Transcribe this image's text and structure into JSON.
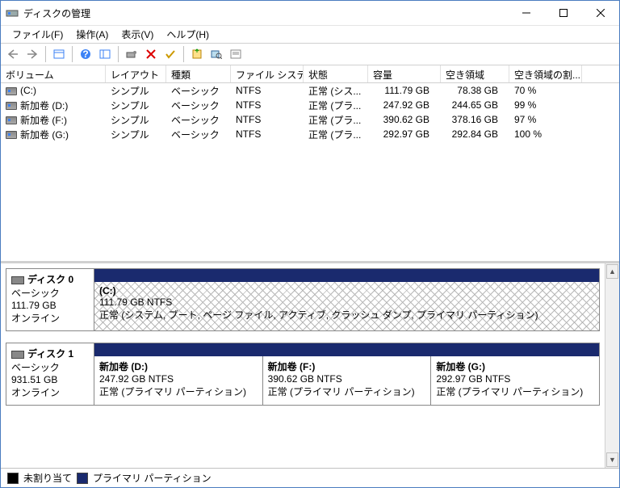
{
  "window": {
    "title": "ディスクの管理"
  },
  "menu": {
    "file": "ファイル(F)",
    "action": "操作(A)",
    "view": "表示(V)",
    "help": "ヘルプ(H)"
  },
  "columns": {
    "volume": "ボリューム",
    "layout": "レイアウト",
    "type": "種類",
    "fs": "ファイル システム",
    "status": "状態",
    "capacity": "容量",
    "free": "空き領域",
    "freepct": "空き領域の割..."
  },
  "volumes": [
    {
      "name": "(C:)",
      "layout": "シンプル",
      "type": "ベーシック",
      "fs": "NTFS",
      "status": "正常 (シス...",
      "capacity": "111.79 GB",
      "free": "78.38 GB",
      "pct": "70 %"
    },
    {
      "name": "新加卷 (D:)",
      "layout": "シンプル",
      "type": "ベーシック",
      "fs": "NTFS",
      "status": "正常 (プラ...",
      "capacity": "247.92 GB",
      "free": "244.65 GB",
      "pct": "99 %"
    },
    {
      "name": "新加卷 (F:)",
      "layout": "シンプル",
      "type": "ベーシック",
      "fs": "NTFS",
      "status": "正常 (プラ...",
      "capacity": "390.62 GB",
      "free": "378.16 GB",
      "pct": "97 %"
    },
    {
      "name": "新加卷 (G:)",
      "layout": "シンプル",
      "type": "ベーシック",
      "fs": "NTFS",
      "status": "正常 (プラ...",
      "capacity": "292.97 GB",
      "free": "292.84 GB",
      "pct": "100 %"
    }
  ],
  "disks": [
    {
      "label": "ディスク 0",
      "type": "ベーシック",
      "size": "111.79 GB",
      "state": "オンライン",
      "parts": [
        {
          "title": "(C:)",
          "sub": "111.79 GB NTFS",
          "desc": "正常 (システム, ブート, ページ ファイル, アクティブ, クラッシュ ダンプ, プライマリ パーティション)",
          "hatch": true
        }
      ]
    },
    {
      "label": "ディスク 1",
      "type": "ベーシック",
      "size": "931.51 GB",
      "state": "オンライン",
      "parts": [
        {
          "title": "新加卷  (D:)",
          "sub": "247.92 GB NTFS",
          "desc": "正常 (プライマリ パーティション)",
          "hatch": false
        },
        {
          "title": "新加卷  (F:)",
          "sub": "390.62 GB NTFS",
          "desc": "正常 (プライマリ パーティション)",
          "hatch": false
        },
        {
          "title": "新加卷  (G:)",
          "sub": "292.97 GB NTFS",
          "desc": "正常 (プライマリ パーティション)",
          "hatch": false
        }
      ]
    }
  ],
  "legend": {
    "unalloc": "未割り当て",
    "primary": "プライマリ パーティション"
  }
}
